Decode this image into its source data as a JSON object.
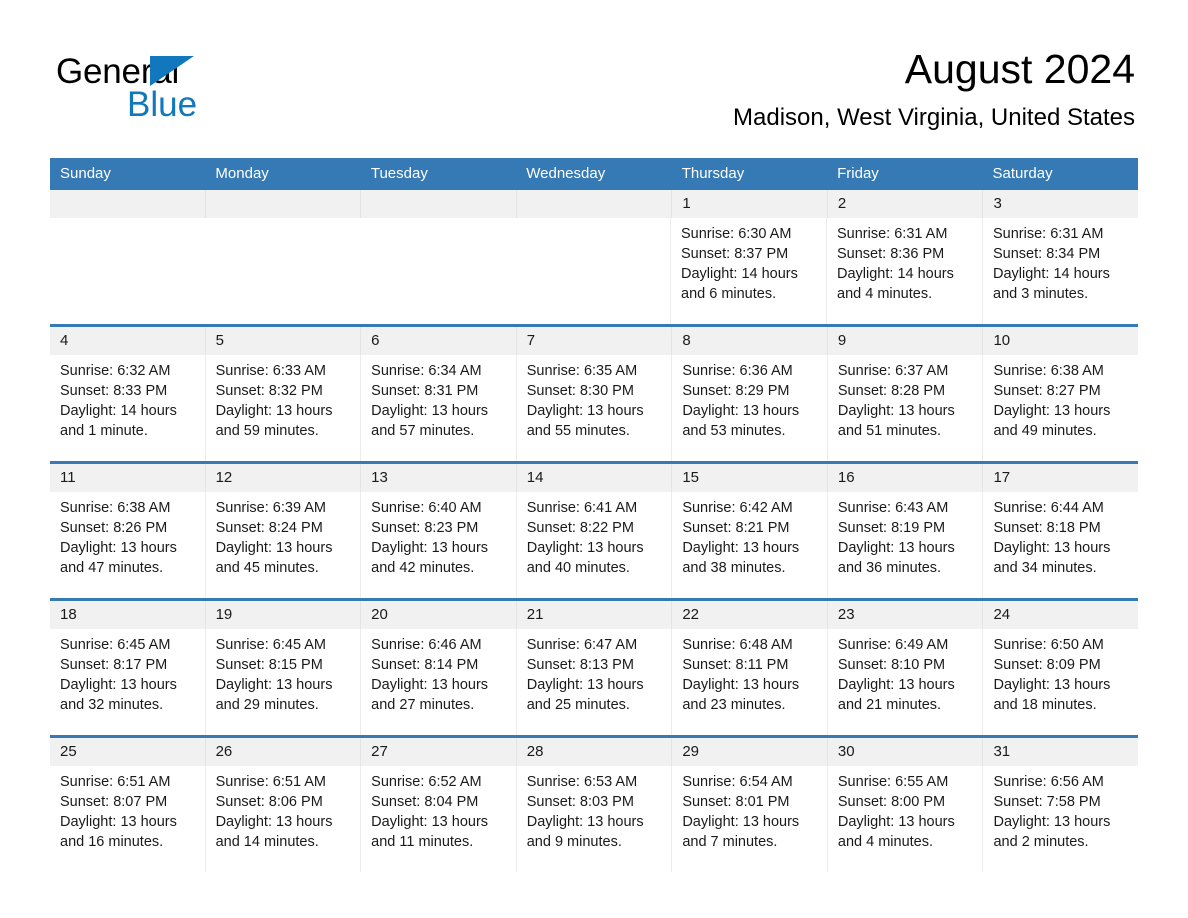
{
  "logo": {
    "word_one": "General",
    "word_two": "Blue",
    "triangle_icon": "triangle-icon",
    "accent_color": "#1278be"
  },
  "header": {
    "title": "August 2024",
    "subtitle": "Madison, West Virginia, United States"
  },
  "theme": {
    "header_blue": "#3579b5",
    "daynum_band": "#f1f1f1",
    "text": "#1a1a1a"
  },
  "calendar": {
    "weekdays": [
      "Sunday",
      "Monday",
      "Tuesday",
      "Wednesday",
      "Thursday",
      "Friday",
      "Saturday"
    ],
    "weeks": [
      [
        {
          "day": "",
          "sunrise": "",
          "sunset": "",
          "daylight_line1": "",
          "daylight_line2": ""
        },
        {
          "day": "",
          "sunrise": "",
          "sunset": "",
          "daylight_line1": "",
          "daylight_line2": ""
        },
        {
          "day": "",
          "sunrise": "",
          "sunset": "",
          "daylight_line1": "",
          "daylight_line2": ""
        },
        {
          "day": "",
          "sunrise": "",
          "sunset": "",
          "daylight_line1": "",
          "daylight_line2": ""
        },
        {
          "day": "1",
          "sunrise": "Sunrise: 6:30 AM",
          "sunset": "Sunset: 8:37 PM",
          "daylight_line1": "Daylight: 14 hours",
          "daylight_line2": "and 6 minutes."
        },
        {
          "day": "2",
          "sunrise": "Sunrise: 6:31 AM",
          "sunset": "Sunset: 8:36 PM",
          "daylight_line1": "Daylight: 14 hours",
          "daylight_line2": "and 4 minutes."
        },
        {
          "day": "3",
          "sunrise": "Sunrise: 6:31 AM",
          "sunset": "Sunset: 8:34 PM",
          "daylight_line1": "Daylight: 14 hours",
          "daylight_line2": "and 3 minutes."
        }
      ],
      [
        {
          "day": "4",
          "sunrise": "Sunrise: 6:32 AM",
          "sunset": "Sunset: 8:33 PM",
          "daylight_line1": "Daylight: 14 hours",
          "daylight_line2": "and 1 minute."
        },
        {
          "day": "5",
          "sunrise": "Sunrise: 6:33 AM",
          "sunset": "Sunset: 8:32 PM",
          "daylight_line1": "Daylight: 13 hours",
          "daylight_line2": "and 59 minutes."
        },
        {
          "day": "6",
          "sunrise": "Sunrise: 6:34 AM",
          "sunset": "Sunset: 8:31 PM",
          "daylight_line1": "Daylight: 13 hours",
          "daylight_line2": "and 57 minutes."
        },
        {
          "day": "7",
          "sunrise": "Sunrise: 6:35 AM",
          "sunset": "Sunset: 8:30 PM",
          "daylight_line1": "Daylight: 13 hours",
          "daylight_line2": "and 55 minutes."
        },
        {
          "day": "8",
          "sunrise": "Sunrise: 6:36 AM",
          "sunset": "Sunset: 8:29 PM",
          "daylight_line1": "Daylight: 13 hours",
          "daylight_line2": "and 53 minutes."
        },
        {
          "day": "9",
          "sunrise": "Sunrise: 6:37 AM",
          "sunset": "Sunset: 8:28 PM",
          "daylight_line1": "Daylight: 13 hours",
          "daylight_line2": "and 51 minutes."
        },
        {
          "day": "10",
          "sunrise": "Sunrise: 6:38 AM",
          "sunset": "Sunset: 8:27 PM",
          "daylight_line1": "Daylight: 13 hours",
          "daylight_line2": "and 49 minutes."
        }
      ],
      [
        {
          "day": "11",
          "sunrise": "Sunrise: 6:38 AM",
          "sunset": "Sunset: 8:26 PM",
          "daylight_line1": "Daylight: 13 hours",
          "daylight_line2": "and 47 minutes."
        },
        {
          "day": "12",
          "sunrise": "Sunrise: 6:39 AM",
          "sunset": "Sunset: 8:24 PM",
          "daylight_line1": "Daylight: 13 hours",
          "daylight_line2": "and 45 minutes."
        },
        {
          "day": "13",
          "sunrise": "Sunrise: 6:40 AM",
          "sunset": "Sunset: 8:23 PM",
          "daylight_line1": "Daylight: 13 hours",
          "daylight_line2": "and 42 minutes."
        },
        {
          "day": "14",
          "sunrise": "Sunrise: 6:41 AM",
          "sunset": "Sunset: 8:22 PM",
          "daylight_line1": "Daylight: 13 hours",
          "daylight_line2": "and 40 minutes."
        },
        {
          "day": "15",
          "sunrise": "Sunrise: 6:42 AM",
          "sunset": "Sunset: 8:21 PM",
          "daylight_line1": "Daylight: 13 hours",
          "daylight_line2": "and 38 minutes."
        },
        {
          "day": "16",
          "sunrise": "Sunrise: 6:43 AM",
          "sunset": "Sunset: 8:19 PM",
          "daylight_line1": "Daylight: 13 hours",
          "daylight_line2": "and 36 minutes."
        },
        {
          "day": "17",
          "sunrise": "Sunrise: 6:44 AM",
          "sunset": "Sunset: 8:18 PM",
          "daylight_line1": "Daylight: 13 hours",
          "daylight_line2": "and 34 minutes."
        }
      ],
      [
        {
          "day": "18",
          "sunrise": "Sunrise: 6:45 AM",
          "sunset": "Sunset: 8:17 PM",
          "daylight_line1": "Daylight: 13 hours",
          "daylight_line2": "and 32 minutes."
        },
        {
          "day": "19",
          "sunrise": "Sunrise: 6:45 AM",
          "sunset": "Sunset: 8:15 PM",
          "daylight_line1": "Daylight: 13 hours",
          "daylight_line2": "and 29 minutes."
        },
        {
          "day": "20",
          "sunrise": "Sunrise: 6:46 AM",
          "sunset": "Sunset: 8:14 PM",
          "daylight_line1": "Daylight: 13 hours",
          "daylight_line2": "and 27 minutes."
        },
        {
          "day": "21",
          "sunrise": "Sunrise: 6:47 AM",
          "sunset": "Sunset: 8:13 PM",
          "daylight_line1": "Daylight: 13 hours",
          "daylight_line2": "and 25 minutes."
        },
        {
          "day": "22",
          "sunrise": "Sunrise: 6:48 AM",
          "sunset": "Sunset: 8:11 PM",
          "daylight_line1": "Daylight: 13 hours",
          "daylight_line2": "and 23 minutes."
        },
        {
          "day": "23",
          "sunrise": "Sunrise: 6:49 AM",
          "sunset": "Sunset: 8:10 PM",
          "daylight_line1": "Daylight: 13 hours",
          "daylight_line2": "and 21 minutes."
        },
        {
          "day": "24",
          "sunrise": "Sunrise: 6:50 AM",
          "sunset": "Sunset: 8:09 PM",
          "daylight_line1": "Daylight: 13 hours",
          "daylight_line2": "and 18 minutes."
        }
      ],
      [
        {
          "day": "25",
          "sunrise": "Sunrise: 6:51 AM",
          "sunset": "Sunset: 8:07 PM",
          "daylight_line1": "Daylight: 13 hours",
          "daylight_line2": "and 16 minutes."
        },
        {
          "day": "26",
          "sunrise": "Sunrise: 6:51 AM",
          "sunset": "Sunset: 8:06 PM",
          "daylight_line1": "Daylight: 13 hours",
          "daylight_line2": "and 14 minutes."
        },
        {
          "day": "27",
          "sunrise": "Sunrise: 6:52 AM",
          "sunset": "Sunset: 8:04 PM",
          "daylight_line1": "Daylight: 13 hours",
          "daylight_line2": "and 11 minutes."
        },
        {
          "day": "28",
          "sunrise": "Sunrise: 6:53 AM",
          "sunset": "Sunset: 8:03 PM",
          "daylight_line1": "Daylight: 13 hours",
          "daylight_line2": "and 9 minutes."
        },
        {
          "day": "29",
          "sunrise": "Sunrise: 6:54 AM",
          "sunset": "Sunset: 8:01 PM",
          "daylight_line1": "Daylight: 13 hours",
          "daylight_line2": "and 7 minutes."
        },
        {
          "day": "30",
          "sunrise": "Sunrise: 6:55 AM",
          "sunset": "Sunset: 8:00 PM",
          "daylight_line1": "Daylight: 13 hours",
          "daylight_line2": "and 4 minutes."
        },
        {
          "day": "31",
          "sunrise": "Sunrise: 6:56 AM",
          "sunset": "Sunset: 7:58 PM",
          "daylight_line1": "Daylight: 13 hours",
          "daylight_line2": "and 2 minutes."
        }
      ]
    ]
  }
}
